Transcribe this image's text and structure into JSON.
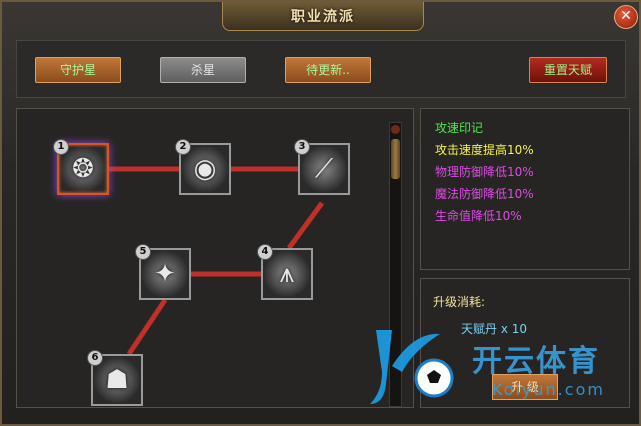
{
  "title": "职业流派",
  "close_label": "✕",
  "toolbar": {
    "tab1": "守护星",
    "tab2": "杀星",
    "tab3": "待更新..",
    "reset": "重置天赋"
  },
  "nodes": [
    {
      "num": "1",
      "icon": "swirl-icon",
      "glyph": "❂"
    },
    {
      "num": "2",
      "icon": "eye-icon",
      "glyph": "◉"
    },
    {
      "num": "3",
      "icon": "blade-icon",
      "glyph": "⟋"
    },
    {
      "num": "4",
      "icon": "claw-icon",
      "glyph": "⩚"
    },
    {
      "num": "5",
      "icon": "figure-icon",
      "glyph": "✦"
    },
    {
      "num": "6",
      "icon": "muscle-icon",
      "glyph": "☗"
    }
  ],
  "info": {
    "name": "攻速印记",
    "line1": "攻击速度提高10%",
    "line2": "物理防御降低10%",
    "line3": "魔法防御降低10%",
    "line4": "生命值降低10%"
  },
  "cost": {
    "label": "升级消耗:",
    "item": "天赋丹 x 10",
    "button": "升 级"
  },
  "watermark": {
    "text": "开云体育",
    "url": "Koiyun.com"
  },
  "colors": {
    "name": "#4de84a",
    "line1": "#f4f44a",
    "debuff": "#e04ae8",
    "cost_label": "#f0e0a0",
    "cost_item": "#7ad0f0",
    "link": "#c0302a"
  }
}
